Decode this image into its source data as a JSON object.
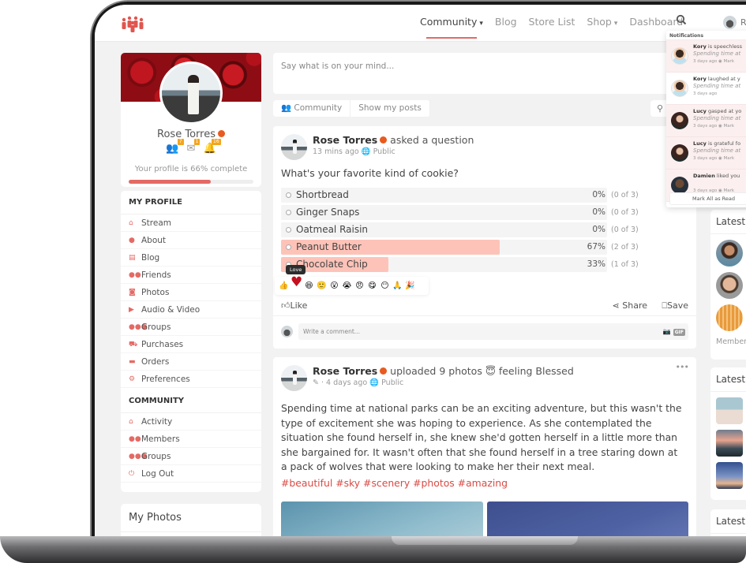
{
  "nav": {
    "items": [
      {
        "label": "Community",
        "has_dropdown": true,
        "active": true
      },
      {
        "label": "Blog",
        "has_dropdown": false
      },
      {
        "label": "Store List",
        "has_dropdown": false
      },
      {
        "label": "Shop",
        "has_dropdown": true
      },
      {
        "label": "Dashboard",
        "has_dropdown": false
      }
    ],
    "user_initial": "R",
    "dropdown_icon": "▾",
    "search_icon": "⚲"
  },
  "profile": {
    "name": "Rose Torres",
    "friend_requests": "7",
    "messages": "1",
    "notifications": "16",
    "completion_text": "Your profile is 66% complete",
    "completion_percent": 66
  },
  "sidebar": {
    "my_profile_heading": "MY PROFILE",
    "my_profile_items": [
      {
        "label": "Stream",
        "icon": "home-icon",
        "glyph": "⌂"
      },
      {
        "label": "About",
        "icon": "user-icon",
        "glyph": "●"
      },
      {
        "label": "Blog",
        "icon": "blog-icon",
        "glyph": "▤"
      },
      {
        "label": "Friends",
        "icon": "friends-icon",
        "glyph": "●●"
      },
      {
        "label": "Photos",
        "icon": "camera-icon",
        "glyph": "◙"
      },
      {
        "label": "Audio & Video",
        "icon": "video-icon",
        "glyph": "▶"
      },
      {
        "label": "Groups",
        "icon": "groups-icon",
        "glyph": "●●●"
      },
      {
        "label": "Purchases",
        "icon": "cart-icon",
        "glyph": "⛟"
      },
      {
        "label": "Orders",
        "icon": "card-icon",
        "glyph": "▬"
      },
      {
        "label": "Preferences",
        "icon": "gear-icon",
        "glyph": "⚙"
      }
    ],
    "community_heading": "COMMUNITY",
    "community_items": [
      {
        "label": "Activity",
        "icon": "home-icon",
        "glyph": "⌂"
      },
      {
        "label": "Members",
        "icon": "members-icon",
        "glyph": "●●"
      },
      {
        "label": "Groups",
        "icon": "groups-icon",
        "glyph": "●●●"
      },
      {
        "label": "Log Out",
        "icon": "power-icon",
        "glyph": "⏻"
      }
    ],
    "my_photos_title": "My Photos"
  },
  "composer": {
    "placeholder": "Say what is on your mind..."
  },
  "filters": {
    "tabs": [
      "Community",
      "Show my posts"
    ]
  },
  "post1": {
    "author": "Rose Torres",
    "action": "asked a question",
    "time": "13 mins ago",
    "visibility": "Public",
    "question": "What's your favorite kind of cookie?",
    "poll": [
      {
        "label": "Shortbread",
        "percent": 0,
        "pct_text": "0%",
        "count": "(0 of 3)"
      },
      {
        "label": "Ginger Snaps",
        "percent": 0,
        "pct_text": "0%",
        "count": "(0 of 3)"
      },
      {
        "label": "Oatmeal Raisin",
        "percent": 0,
        "pct_text": "0%",
        "count": "(0 of 3)"
      },
      {
        "label": "Peanut Butter",
        "percent": 67,
        "pct_text": "67%",
        "count": "(2 of 3)"
      },
      {
        "label": "Chocolate Chip",
        "percent": 33,
        "pct_text": "33%",
        "count": "(1 of 3)"
      }
    ],
    "reaction_tooltip": "Love",
    "reactions": [
      "like",
      "love",
      "haha",
      "smile",
      "wow",
      "cry",
      "angry",
      "yum",
      "neutral",
      "pray",
      "party"
    ],
    "like_label": "Like",
    "share_label": "Share",
    "save_label": "Save",
    "comment_placeholder": "Write a comment...",
    "gif_label": "GIF"
  },
  "post2": {
    "author": "Rose Torres",
    "action": "uploaded 9 photos",
    "feeling": "feeling Blessed",
    "time": "4 days ago",
    "visibility": "Public",
    "body": "Spending time at national parks can be an exciting adventure, but this wasn't the type of excitement she was hoping to experience. As she contemplated the situation she found herself in, she knew she'd gotten herself in a little more than she bargained for. It wasn't often that she found herself in a tree staring down at a pack of wolves that were looking to make her their next meal.",
    "hashtags": "#beautiful #sky #scenery #photos #amazing",
    "more_label": "•••"
  },
  "right": {
    "latest_members_title": "Latest Members",
    "members_link": "Members",
    "latest_photos_title": "Latest Photos",
    "latest_third_title": "Latest"
  },
  "notifications": {
    "heading": "Notifications",
    "items": [
      {
        "name": "Kory",
        "text": "is speechless",
        "quote": "Spending time at",
        "time": "3 days ago",
        "mark": "Mark",
        "unread": true,
        "avatar": "kory"
      },
      {
        "name": "Kory",
        "text": "laughed at y",
        "quote": "Spending time at",
        "time": "3 days ago",
        "mark": "",
        "unread": false,
        "avatar": "kory"
      },
      {
        "name": "Lucy",
        "text": "gasped at yo",
        "quote": "Spending time at",
        "time": "3 days ago",
        "mark": "Mark",
        "unread": true,
        "avatar": "lucy"
      },
      {
        "name": "Lucy",
        "text": "is grateful fo",
        "quote": "Spending time at",
        "time": "3 days ago",
        "mark": "Mark",
        "unread": true,
        "avatar": "lucy"
      },
      {
        "name": "Damien",
        "text": "liked you",
        "quote": "",
        "time": "3 days ago",
        "mark": "Mark",
        "unread": true,
        "avatar": "damien"
      }
    ],
    "mark_all": "Mark All as Read"
  },
  "colors": {
    "accent": "#e46a65",
    "poll_fill": "#fec3b8",
    "hashtag": "#d94b44",
    "badge": "#f4a51c"
  }
}
